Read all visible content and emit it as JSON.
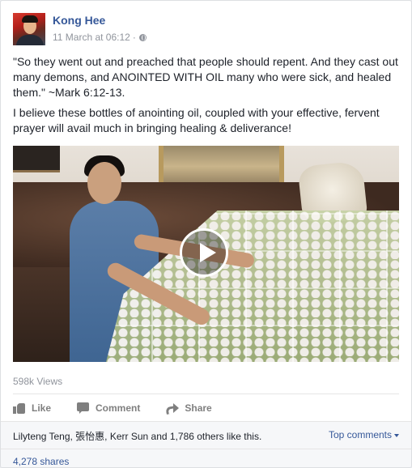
{
  "post": {
    "author": "Kong Hee",
    "timestamp": "11 March at 06:12",
    "separator": "·",
    "privacy_icon": "globe-icon",
    "paragraphs": [
      "\"So they went out and preached that people should repent. And they cast out many demons, and ANOINTED WITH OIL many who were sick, and healed them.\" ~Mark 6:12-13.",
      "I believe these bottles of anointing oil, coupled with your effective, fervent prayer will avail much in bringing healing & deliverance!"
    ]
  },
  "video": {
    "play_icon": "play-icon",
    "views": "598k Views"
  },
  "actions": {
    "like_label": "Like",
    "comment_label": "Comment",
    "share_label": "Share"
  },
  "footer": {
    "likes_text": "Lilyteng Teng, 張怡惠, Kerr Sun and 1,786 others like this.",
    "top_comments": "Top comments",
    "shares": "4,278 shares"
  },
  "colors": {
    "link_blue": "#365899",
    "meta_gray": "#90949c",
    "action_gray": "#7f7f7f"
  }
}
